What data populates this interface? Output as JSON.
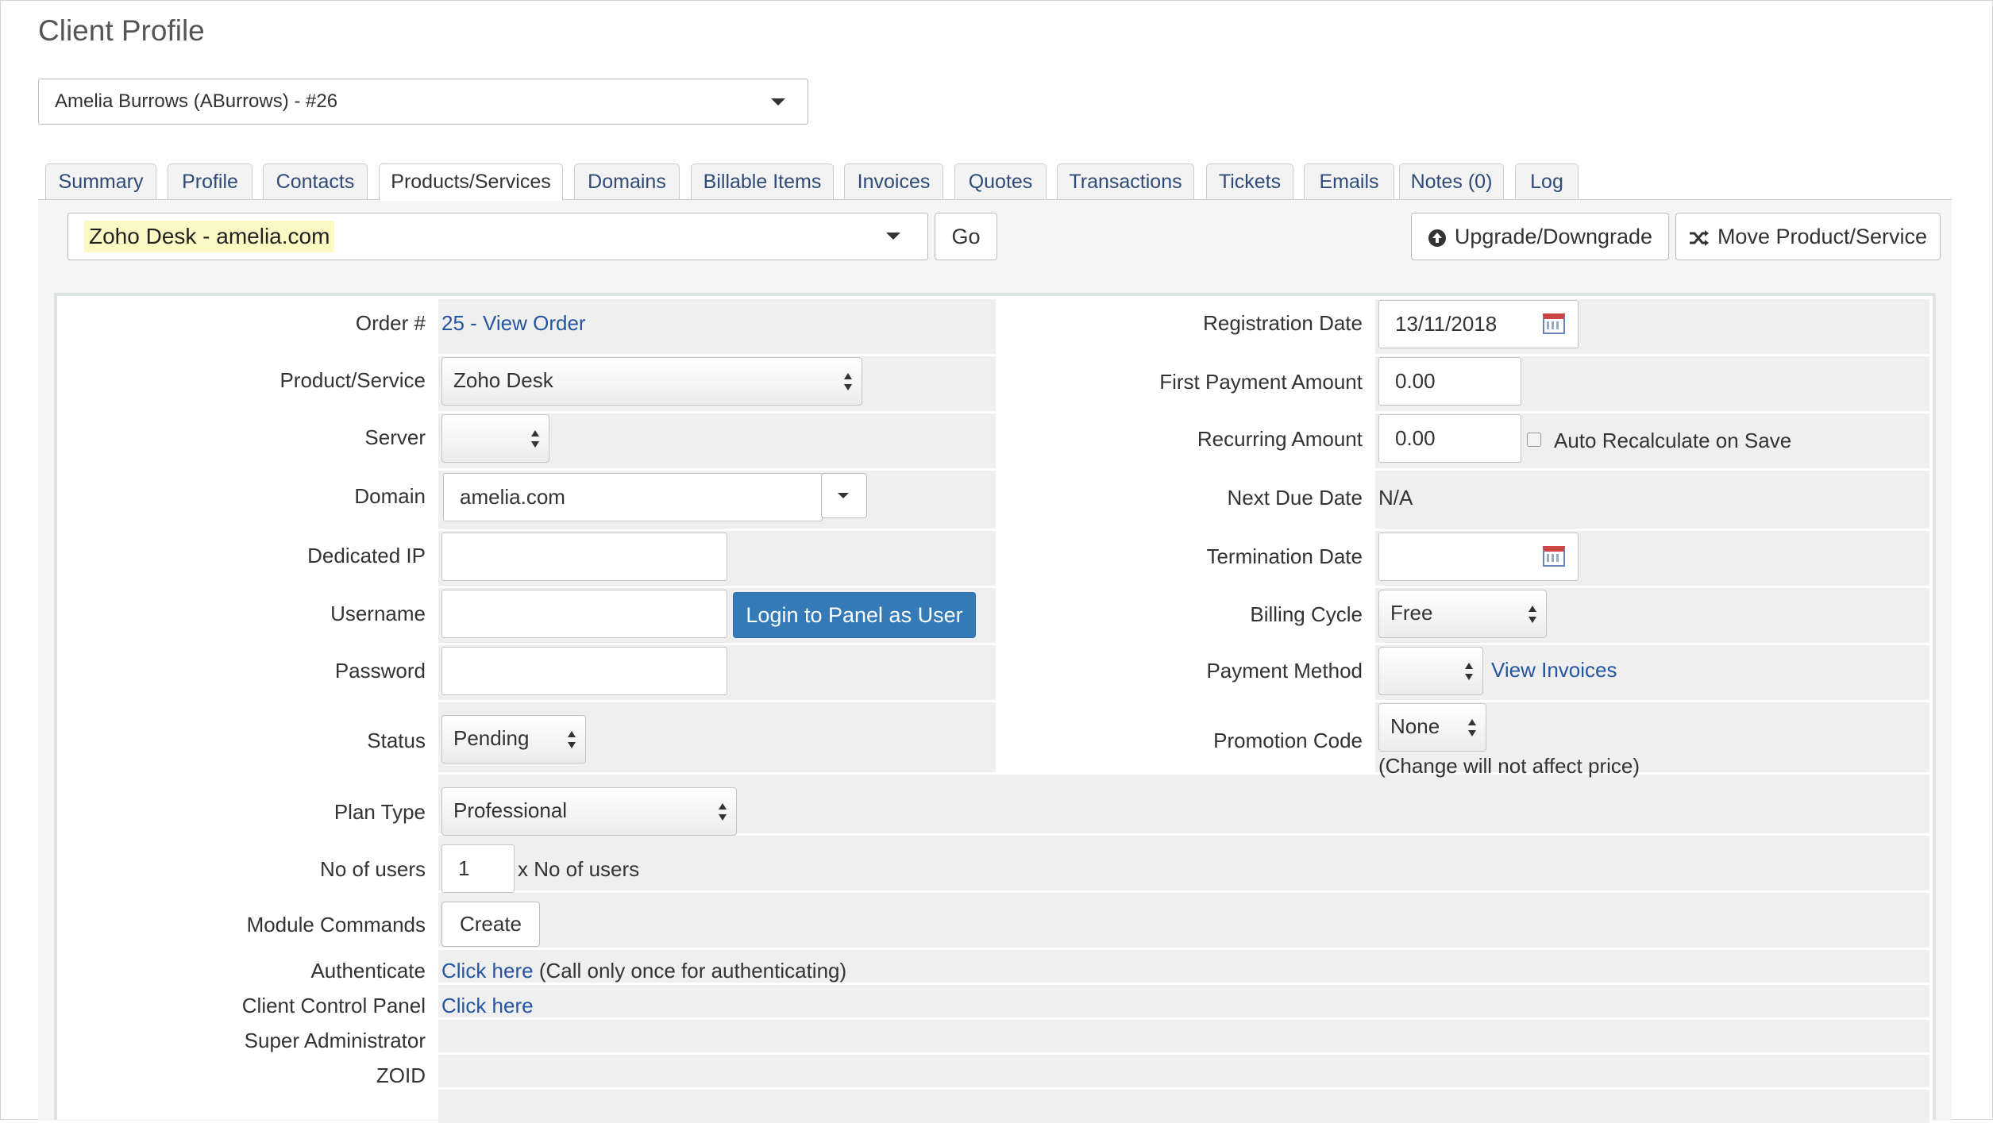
{
  "page": {
    "title": "Client Profile"
  },
  "client_selector": {
    "value": "Amelia Burrows (ABurrows) - #26"
  },
  "tabs": [
    {
      "label": "Summary"
    },
    {
      "label": "Profile"
    },
    {
      "label": "Contacts"
    },
    {
      "label": "Products/Services",
      "active": true
    },
    {
      "label": "Domains"
    },
    {
      "label": "Billable Items"
    },
    {
      "label": "Invoices"
    },
    {
      "label": "Quotes"
    },
    {
      "label": "Transactions"
    },
    {
      "label": "Tickets"
    },
    {
      "label": "Emails"
    },
    {
      "label": "Notes (0)"
    },
    {
      "label": "Log"
    }
  ],
  "service_bar": {
    "selected_service": "Zoho Desk - amelia.com",
    "go_label": "Go",
    "upgrade_label": "Upgrade/Downgrade",
    "move_label": "Move Product/Service"
  },
  "form": {
    "order": {
      "label": "Order #",
      "value": "25 - View Order"
    },
    "product_service": {
      "label": "Product/Service",
      "value": "Zoho Desk"
    },
    "server": {
      "label": "Server",
      "value": ""
    },
    "domain": {
      "label": "Domain",
      "value": "amelia.com"
    },
    "dedicated_ip": {
      "label": "Dedicated IP",
      "value": ""
    },
    "username": {
      "label": "Username",
      "value": "",
      "login_button": "Login to Panel as User"
    },
    "password": {
      "label": "Password",
      "value": ""
    },
    "status": {
      "label": "Status",
      "value": "Pending"
    },
    "registration_date": {
      "label": "Registration Date",
      "value": "13/11/2018"
    },
    "first_payment_amount": {
      "label": "First Payment Amount",
      "value": "0.00"
    },
    "recurring_amount": {
      "label": "Recurring Amount",
      "value": "0.00",
      "auto_recalc_label": "Auto Recalculate on Save"
    },
    "next_due_date": {
      "label": "Next Due Date",
      "value": "N/A"
    },
    "termination_date": {
      "label": "Termination Date",
      "value": ""
    },
    "billing_cycle": {
      "label": "Billing Cycle",
      "value": "Free"
    },
    "payment_method": {
      "label": "Payment Method",
      "value": "",
      "link": "View Invoices"
    },
    "promotion_code": {
      "label": "Promotion Code",
      "value": "None",
      "note": "(Change will not affect price)"
    },
    "plan_type": {
      "label": "Plan Type",
      "value": "Professional"
    },
    "no_of_users": {
      "label": "No of users",
      "value": "1",
      "suffix": "x No of users"
    },
    "module_commands": {
      "label": "Module Commands",
      "button": "Create"
    },
    "authenticate": {
      "label": "Authenticate",
      "link": "Click here",
      "note": "(Call only once for authenticating)"
    },
    "client_control_panel": {
      "label": "Client Control Panel",
      "link": "Click here"
    },
    "super_administrator": {
      "label": "Super Administrator",
      "value": ""
    },
    "zoid": {
      "label": "ZOID",
      "value": ""
    }
  },
  "colors": {
    "primary_button": "#337ab7",
    "link": "#2455a0",
    "highlight": "#fcf8c4",
    "row_gray": "#efefef",
    "tab_link": "#2d4a78"
  },
  "icons": [
    "caret-down-icon",
    "up-down-arrows-icon",
    "calendar-icon",
    "arrow-circle-up-icon",
    "shuffle-icon"
  ]
}
